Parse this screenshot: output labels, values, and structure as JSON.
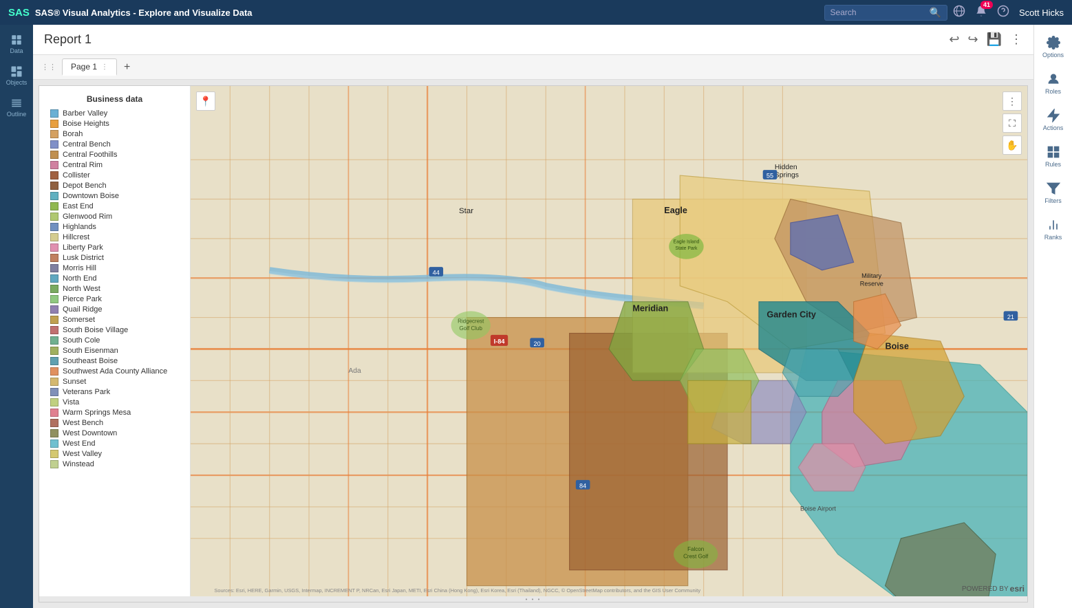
{
  "app": {
    "title": "SAS® Visual Analytics - Explore and Visualize Data",
    "search_placeholder": "Search"
  },
  "topbar": {
    "user_name": "Scott Hicks",
    "notification_count": "41"
  },
  "report": {
    "title": "Report 1",
    "page_tab": "Page 1"
  },
  "legend": {
    "title": "Business data",
    "items": [
      {
        "label": "Barber Valley",
        "color": "#6ab0d4"
      },
      {
        "label": "Boise Heights",
        "color": "#e8a040"
      },
      {
        "label": "Borah",
        "color": "#d4a060"
      },
      {
        "label": "Central Bench",
        "color": "#8090c8"
      },
      {
        "label": "Central Foothills",
        "color": "#c09050"
      },
      {
        "label": "Central Rim",
        "color": "#d080a0"
      },
      {
        "label": "Collister",
        "color": "#a06040"
      },
      {
        "label": "Depot Bench",
        "color": "#906040"
      },
      {
        "label": "Downtown Boise",
        "color": "#60b0c0"
      },
      {
        "label": "East End",
        "color": "#90b850"
      },
      {
        "label": "Glenwood Rim",
        "color": "#b0c870"
      },
      {
        "label": "Highlands",
        "color": "#7090c0"
      },
      {
        "label": "Hillcrest",
        "color": "#d4cc90"
      },
      {
        "label": "Liberty Park",
        "color": "#e090b0"
      },
      {
        "label": "Lusk District",
        "color": "#c08060"
      },
      {
        "label": "Morris Hill",
        "color": "#8080a0"
      },
      {
        "label": "North End",
        "color": "#60a8c0"
      },
      {
        "label": "North West",
        "color": "#7aaa60"
      },
      {
        "label": "Pierce Park",
        "color": "#90c880"
      },
      {
        "label": "Quail Ridge",
        "color": "#9080b0"
      },
      {
        "label": "Somerset",
        "color": "#c0a050"
      },
      {
        "label": "South Boise Village",
        "color": "#c07070"
      },
      {
        "label": "South Cole",
        "color": "#70b090"
      },
      {
        "label": "South Eisenman",
        "color": "#a0b060"
      },
      {
        "label": "Southeast Boise",
        "color": "#60a0b0"
      },
      {
        "label": "Southwest Ada County Alliance",
        "color": "#e09060"
      },
      {
        "label": "Sunset",
        "color": "#d4b870"
      },
      {
        "label": "Veterans Park",
        "color": "#8090b8"
      },
      {
        "label": "Vista",
        "color": "#c0d080"
      },
      {
        "label": "Warm Springs Mesa",
        "color": "#e08090"
      },
      {
        "label": "West Bench",
        "color": "#b07060"
      },
      {
        "label": "West Downtown",
        "color": "#909060"
      },
      {
        "label": "West End",
        "color": "#70c0d0"
      },
      {
        "label": "West Valley",
        "color": "#d4c870"
      },
      {
        "label": "Winstead",
        "color": "#c0d090"
      }
    ]
  },
  "sidebar_left": {
    "items": [
      {
        "label": "Data",
        "icon": "data"
      },
      {
        "label": "Objects",
        "icon": "objects"
      },
      {
        "label": "Outline",
        "icon": "outline"
      }
    ]
  },
  "sidebar_right": {
    "items": [
      {
        "label": "Options",
        "icon": "options"
      },
      {
        "label": "Roles",
        "icon": "roles"
      },
      {
        "label": "Actions",
        "icon": "actions"
      },
      {
        "label": "Rules",
        "icon": "rules"
      },
      {
        "label": "Filters",
        "icon": "filters"
      },
      {
        "label": "Ranks",
        "icon": "ranks"
      }
    ]
  }
}
